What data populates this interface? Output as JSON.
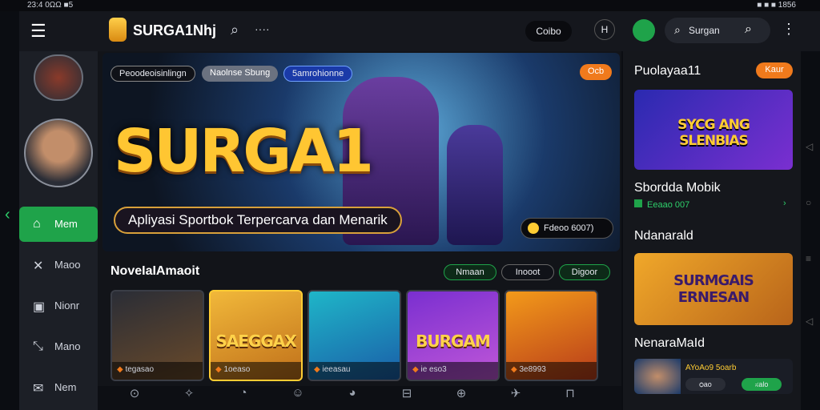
{
  "status": {
    "left": "23:4 0ΩΩ ■5",
    "right": "■ ■ ■ 1856"
  },
  "header": {
    "brand": "SURGA1Nhj",
    "search_icon": "search-icon",
    "more": "····",
    "pill": "Coibo",
    "pill_icon": "H",
    "search_text": "Surgan",
    "menu": "⋮"
  },
  "sidebar": {
    "items": [
      {
        "label": "Mem",
        "icon": "home-icon",
        "active": true
      },
      {
        "label": "Maoo",
        "icon": "cross-icon"
      },
      {
        "label": "Nionr",
        "icon": "box-icon"
      },
      {
        "label": "Mano",
        "icon": "chart-icon"
      },
      {
        "label": "Nem",
        "icon": "chat-icon"
      }
    ]
  },
  "hero": {
    "tags": [
      "Peoodeoisinlingn",
      "Naolnse Sbung",
      "5amrohionne"
    ],
    "badge": "Ocb",
    "title": "SURGA1",
    "subtitle": "Apliyasi Sportbok Terpercarva dan Menarik",
    "cta": "Fdeoo 6007)"
  },
  "games": {
    "title": "NoveIaIAmaoit",
    "filters": [
      "Nmaan",
      "Inooot",
      "Digoor"
    ],
    "items": [
      {
        "name": "",
        "label": "tegasao",
        "colors": [
          "#2a2d36",
          "#6a4a2a"
        ]
      },
      {
        "name": "SAEGGAX",
        "label": "1oeaso",
        "colors": [
          "#f1b83a",
          "#c0701a"
        ]
      },
      {
        "name": "",
        "label": "ieeasau",
        "colors": [
          "#1fb6c8",
          "#1a5ea8"
        ]
      },
      {
        "name": "BURGAM",
        "label": "ie eso3",
        "colors": [
          "#7a2fd0",
          "#c057d8"
        ]
      },
      {
        "name": "",
        "label": "3e8993",
        "colors": [
          "#f39a1a",
          "#b83c1a"
        ]
      }
    ]
  },
  "right": {
    "title": "Puolayaa11",
    "button": "Kaur",
    "cards": [
      {
        "name": "SYCG ANG SLENBIAS",
        "title": "Sbordda Mobik",
        "sub": "Eeaao 007"
      },
      {
        "name": "SURMGAIS ERNESAN",
        "title": "Ndanarald",
        "sub": ""
      },
      {
        "name": "",
        "title": "NenaraMaId",
        "sub": "AYoAo9 5oarb"
      }
    ],
    "promo_btns": [
      "ѻao",
      "ಸalo"
    ]
  },
  "bottom_nav": [
    "⊙",
    "✧",
    "◔",
    "☺",
    "◕",
    "⊟",
    "⊕",
    "✈",
    "⊓"
  ],
  "colors": {
    "accent": "#1fa34a",
    "orange": "#f07a1c",
    "gold": "#ffcc33"
  }
}
